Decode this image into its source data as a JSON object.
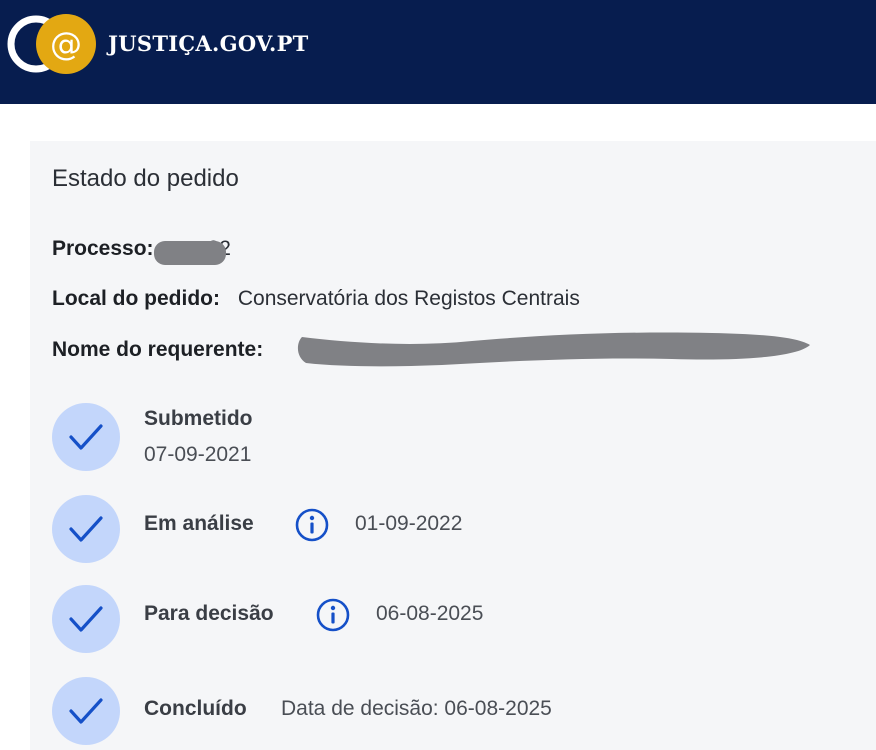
{
  "header": {
    "site_name": "JUSTIÇA.GOV.PT",
    "logo_icon": "justica-logo-icon",
    "background_color": "#071d4f",
    "logo_accent_color": "#e3a812"
  },
  "panel": {
    "title": "Estado do pedido",
    "fields": {
      "processo": {
        "label": "Processo:",
        "value": "22",
        "redacted": true
      },
      "local": {
        "label": "Local do pedido:",
        "value": "Conservatória dos Registos Centrais"
      },
      "requerente": {
        "label": "Nome do requerente:",
        "value": "",
        "redacted": true
      }
    }
  },
  "steps": [
    {
      "label": "Submetido",
      "date": "07-09-2021",
      "icon": "check-icon",
      "info": false
    },
    {
      "label": "Em análise",
      "date": "01-09-2022",
      "icon": "check-icon",
      "info": true
    },
    {
      "label": "Para decisão",
      "date": "06-08-2025",
      "icon": "check-icon",
      "info": true
    },
    {
      "label": "Concluído",
      "date": "Data de decisão: 06-08-2025",
      "icon": "check-icon",
      "info": false
    }
  ],
  "colors": {
    "step_circle": "#c3d6fb",
    "check": "#1550c8",
    "info_icon": "#1550c8",
    "panel_bg": "#f5f6f8",
    "redaction": "#808185"
  }
}
